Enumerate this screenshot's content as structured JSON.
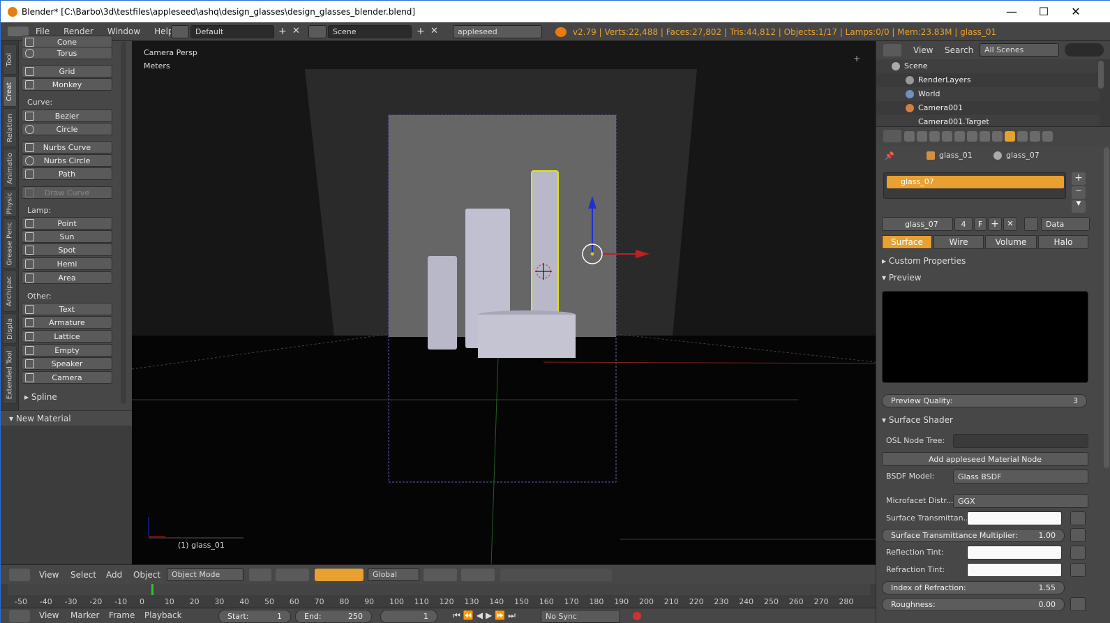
{
  "window": {
    "title": "Blender* [C:\\Barbo\\3d\\testfiles\\appleseed\\ashq\\design_glasses\\design_glasses_blender.blend]",
    "minimize": "—",
    "maximize": "☐",
    "close": "✕"
  },
  "topmenu": {
    "file": "File",
    "render": "Render",
    "window": "Window",
    "help": "Help",
    "layout": "Default",
    "scene": "Scene",
    "engine": "appleseed",
    "stats": "v2.79 | Verts:22,488 | Faces:27,802 | Tris:44,812 | Objects:1/17 | Lamps:0/0 | Mem:23.83M | glass_01"
  },
  "vtabs": [
    "Tool",
    "Creat",
    "Relation",
    "Animatio",
    "Physic",
    "Grease Penc",
    "Archipac",
    "Displa",
    "Extended Tool"
  ],
  "toolshelf": {
    "top_partial": "Cone",
    "torus": "Torus",
    "grid": "Grid",
    "monkey": "Monkey",
    "curve_label": "Curve:",
    "bezier": "Bezier",
    "circle": "Circle",
    "nurbs_curve": "Nurbs Curve",
    "nurbs_circle": "Nurbs Circle",
    "path": "Path",
    "draw_curve": "Draw Curve",
    "lamp_label": "Lamp:",
    "point": "Point",
    "sun": "Sun",
    "spot": "Spot",
    "hemi": "Hemi",
    "area": "Area",
    "other_label": "Other:",
    "text": "Text",
    "armature": "Armature",
    "lattice": "Lattice",
    "empty": "Empty",
    "speaker": "Speaker",
    "camera": "Camera",
    "spline": "Spline",
    "new_material": "New Material"
  },
  "viewport": {
    "view_name": "Camera Persp",
    "units": "Meters",
    "object_label": "(1) glass_01"
  },
  "header3d": {
    "view": "View",
    "select": "Select",
    "add": "Add",
    "object": "Object",
    "mode": "Object Mode",
    "orientation": "Global"
  },
  "timeline": {
    "ticks": [
      "-50",
      "-40",
      "-30",
      "-20",
      "-10",
      "0",
      "10",
      "20",
      "30",
      "40",
      "50",
      "60",
      "70",
      "80",
      "90",
      "100",
      "110",
      "120",
      "130",
      "140",
      "150",
      "160",
      "170",
      "180",
      "190",
      "200",
      "210",
      "220",
      "230",
      "240",
      "250",
      "260",
      "270",
      "280"
    ]
  },
  "tlheader": {
    "view": "View",
    "marker": "Marker",
    "frame": "Frame",
    "playback": "Playback",
    "start_label": "Start:",
    "start": "1",
    "end_label": "End:",
    "end": "250",
    "current": "1",
    "sync": "No Sync"
  },
  "outliner": {
    "view": "View",
    "search": "Search",
    "filter": "All Scenes",
    "items": [
      "Scene",
      "RenderLayers",
      "World",
      "Camera001",
      "Camera001.Target"
    ]
  },
  "properties": {
    "crumb_object": "glass_01",
    "crumb_material": "glass_07",
    "slot": "glass_07",
    "mat_name": "glass_07",
    "users": "4",
    "fake": "F",
    "data": "Data",
    "tabs": [
      "Surface",
      "Wire",
      "Volume",
      "Halo"
    ],
    "custom_props": "Custom Properties",
    "preview": "Preview",
    "preview_quality_label": "Preview Quality:",
    "preview_quality": "3",
    "surface_shader": "Surface Shader",
    "osl_label": "OSL Node Tree:",
    "add_node": "Add appleseed Material Node",
    "bsdf_label": "BSDF Model:",
    "bsdf": "Glass BSDF",
    "micro_label": "Microfacet Distr...",
    "micro": "GGX",
    "transmittance_label": "Surface Transmittan...",
    "transmult_label": "Surface Transmittance Multiplier:",
    "transmult": "1.00",
    "refl_label": "Reflection Tint:",
    "refr_label": "Refraction Tint:",
    "ior_label": "Index of Refraction:",
    "ior": "1.55",
    "rough_label": "Roughness:",
    "rough": "0.00"
  },
  "colors": {
    "accent": "#e8a030",
    "selected_outline": "#e0e020",
    "axis_x": "#c02020",
    "axis_y": "#20a020",
    "axis_z": "#2030d0"
  }
}
